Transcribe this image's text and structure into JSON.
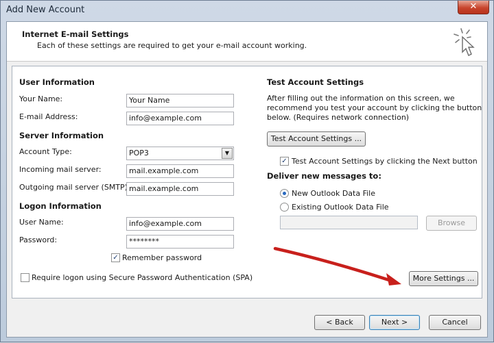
{
  "window": {
    "title": "Add New Account",
    "close_glyph": "✕"
  },
  "header": {
    "title": "Internet E-mail Settings",
    "subtitle": "Each of these settings are required to get your e-mail account working.",
    "icon": "cursor-click-icon"
  },
  "user_info": {
    "heading": "User Information",
    "name_label": "Your Name:",
    "name_value": "Your Name",
    "email_label": "E-mail Address:",
    "email_value": "info@example.com"
  },
  "server_info": {
    "heading": "Server Information",
    "account_type_label": "Account Type:",
    "account_type_value": "POP3",
    "incoming_label": "Incoming mail server:",
    "incoming_value": "mail.example.com",
    "outgoing_label": "Outgoing mail server (SMTP):",
    "outgoing_value": "mail.example.com"
  },
  "logon_info": {
    "heading": "Logon Information",
    "username_label": "User Name:",
    "username_value": "info@example.com",
    "password_label": "Password:",
    "password_value": "********",
    "remember_label": "Remember password",
    "remember_checked": true,
    "spa_label": "Require logon using Secure Password Authentication (SPA)",
    "spa_checked": false
  },
  "test_settings": {
    "heading": "Test Account Settings",
    "description_1": "After filling out the information on this screen, we",
    "description_2": "recommend you test your account by clicking the button",
    "description_3": "below. (Requires network connection)",
    "test_button": "Test Account Settings ...",
    "auto_test_label": "Test Account Settings by clicking the Next button",
    "auto_test_checked": true
  },
  "deliver": {
    "heading": "Deliver new messages to:",
    "new_file_label": "New Outlook Data File",
    "existing_file_label": "Existing Outlook Data File",
    "selected": "new",
    "existing_path_value": "",
    "browse_button": "Browse"
  },
  "more_settings_button": "More Settings ...",
  "footer": {
    "back_button": "< Back",
    "next_button": "Next >",
    "cancel_button": "Cancel"
  },
  "annotation": {
    "arrow_color": "#c8201c"
  },
  "colors": {
    "titlebar_bg": "#c9d6e5",
    "close_button": "#c8452d",
    "checkbox_mark": "#1c3d72"
  }
}
